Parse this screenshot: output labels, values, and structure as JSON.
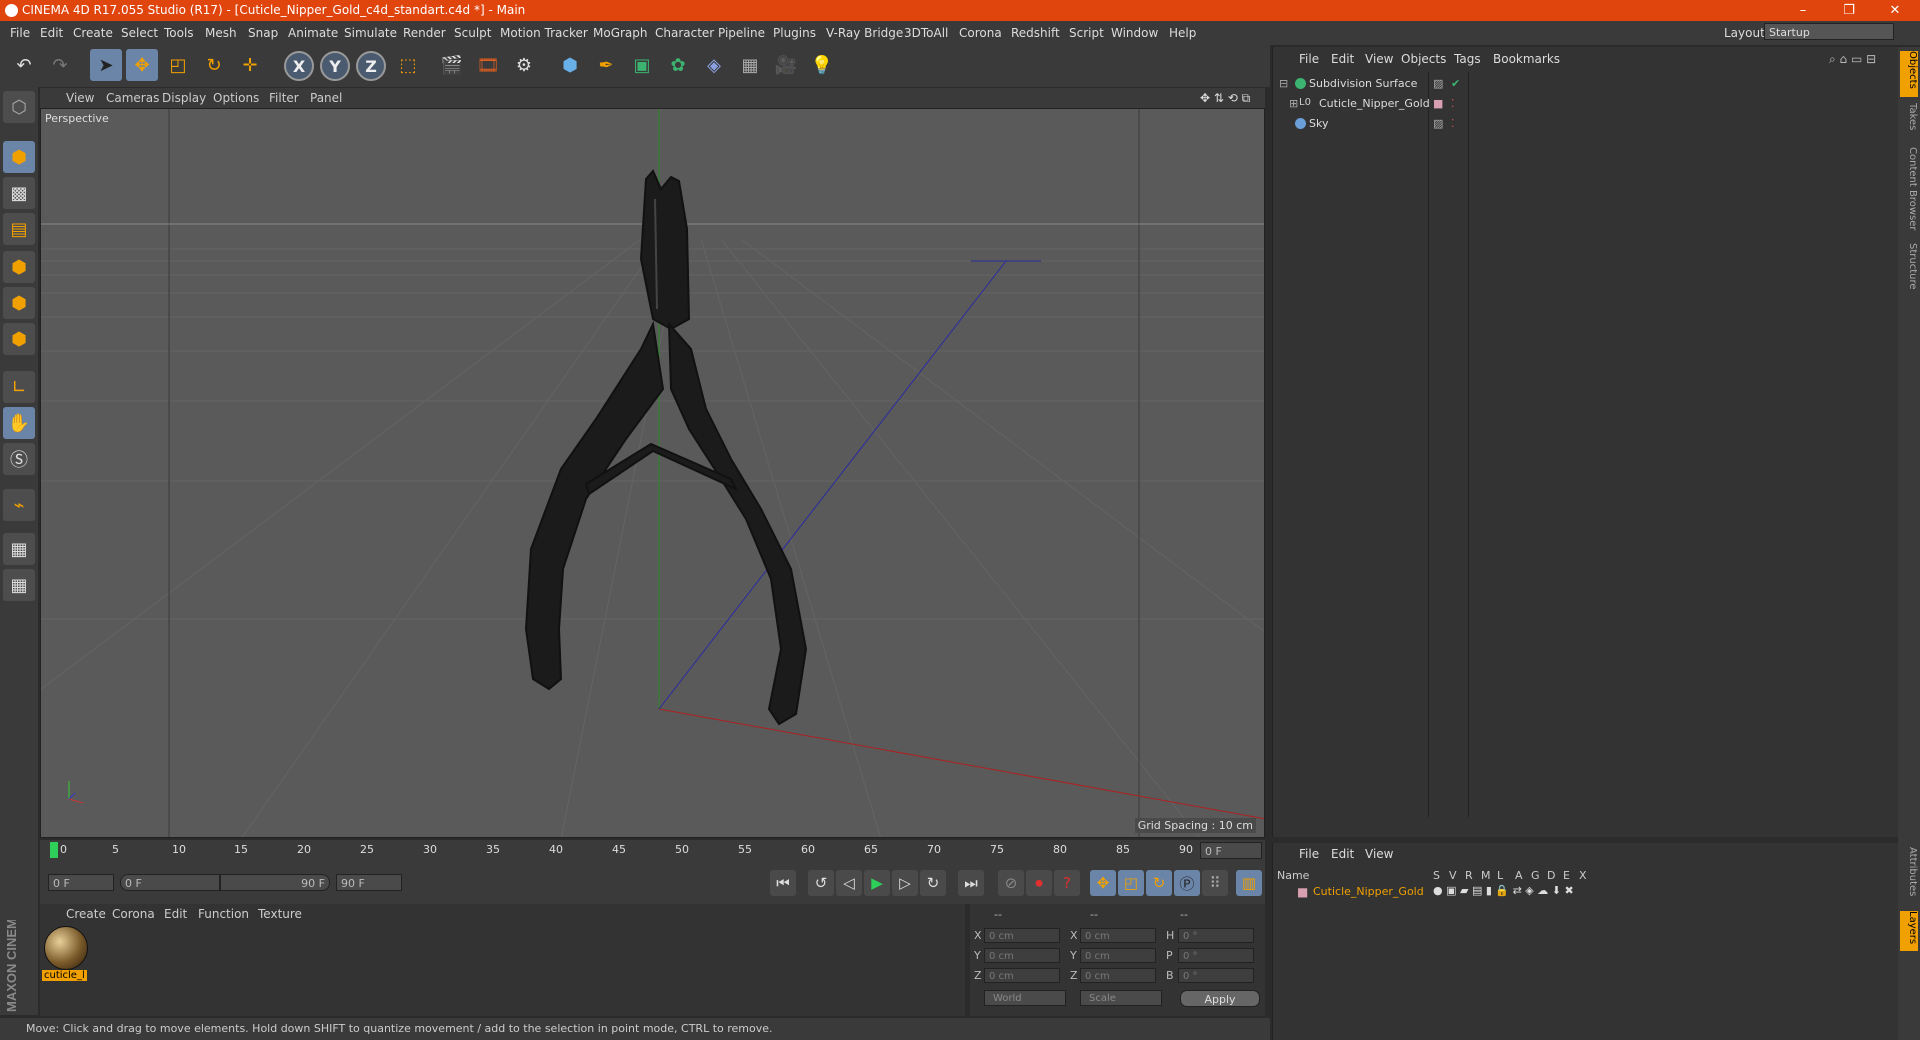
{
  "window": {
    "title": "CINEMA 4D R17.055 Studio (R17) - [Cuticle_Nipper_Gold_c4d_standart.c4d *] - Main",
    "controls": [
      "–",
      "❐",
      "✕"
    ]
  },
  "menubar": {
    "items": [
      "File",
      "Edit",
      "Create",
      "Select",
      "Tools",
      "Mesh",
      "Snap",
      "Animate",
      "Simulate",
      "Render",
      "Sculpt",
      "Motion Tracker",
      "MoGraph",
      "Character",
      "Pipeline",
      "Plugins",
      "V-Ray Bridge",
      "3DToAll",
      "Corona",
      "Redshift",
      "Script",
      "Window",
      "Help"
    ],
    "layout_label": "Layout:",
    "layout_value": "Startup"
  },
  "toolbar": {
    "axis": [
      "X",
      "Y",
      "Z"
    ]
  },
  "viewport": {
    "menu": [
      "View",
      "Cameras",
      "Display",
      "Options",
      "Filter",
      "Panel"
    ],
    "label": "Perspective",
    "grid_spacing": "Grid Spacing : 10 cm"
  },
  "timeline": {
    "ticks": [
      "0",
      "5",
      "10",
      "15",
      "20",
      "25",
      "30",
      "35",
      "40",
      "45",
      "50",
      "55",
      "60",
      "65",
      "70",
      "75",
      "80",
      "85",
      "90"
    ],
    "end_field": "0 F",
    "start": "0 F",
    "range_start": "0 F",
    "range_end": "90 F",
    "max": "90 F"
  },
  "material_manager": {
    "menu": [
      "Create",
      "Corona",
      "Edit",
      "Function",
      "Texture"
    ],
    "material_name": "cuticle_l"
  },
  "coords": {
    "headers": [
      "--",
      "--",
      "--"
    ],
    "rows": [
      {
        "a": "X",
        "av": "0 cm",
        "b": "X",
        "bv": "0 cm",
        "c": "H",
        "cv": "0 °"
      },
      {
        "a": "Y",
        "av": "0 cm",
        "b": "Y",
        "bv": "0 cm",
        "c": "P",
        "cv": "0 °"
      },
      {
        "a": "Z",
        "av": "0 cm",
        "b": "Z",
        "bv": "0 cm",
        "c": "B",
        "cv": "0 °"
      }
    ],
    "mode": "World",
    "type": "Scale",
    "apply": "Apply"
  },
  "status": "Move: Click and drag to move elements. Hold down SHIFT to quantize movement / add to the selection in point mode, CTRL to remove.",
  "object_manager": {
    "menu": [
      "File",
      "Edit",
      "View",
      "Objects",
      "Tags",
      "Bookmarks"
    ],
    "objects": [
      {
        "name": "Subdivision Surface",
        "color": "#3cb371"
      },
      {
        "name": "Cuticle_Nipper_Gold",
        "color": "#999999"
      },
      {
        "name": "Sky",
        "color": "#6a9fd8"
      }
    ]
  },
  "attributes": {
    "menu": [
      "File",
      "Edit",
      "View"
    ],
    "columns": [
      "Name",
      "S",
      "V",
      "R",
      "M",
      "L",
      "A",
      "G",
      "D",
      "E",
      "X"
    ],
    "layer_name": "Cuticle_Nipper_Gold"
  },
  "right_tabs": [
    "Objects",
    "Takes",
    "Content Browser",
    "Structure",
    "Attributes",
    "Layers"
  ],
  "brand": "MAXON CINEMA 4D",
  "accent": "#e0450e"
}
